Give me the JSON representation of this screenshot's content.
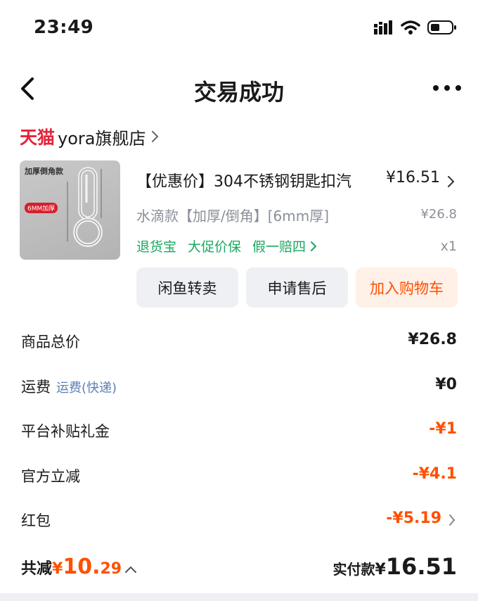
{
  "status_bar": {
    "time": "23:49"
  },
  "nav": {
    "title": "交易成功"
  },
  "shop": {
    "platform": "天猫",
    "name": "yora旗舰店"
  },
  "product": {
    "image_text_top": "加厚倒角款",
    "image_text_badge": "6MM加厚",
    "title": "【优惠价】304不锈钢钥匙扣汽",
    "price": "¥16.51",
    "spec": "水滴款【加厚/倒角】[6mm厚]",
    "original_price": "¥26.8",
    "services": [
      "退货宝",
      "大促价保",
      "假一赔四"
    ],
    "quantity": "x1"
  },
  "actions": {
    "resell": "闲鱼转卖",
    "after_sale": "申请售后",
    "add_cart": "加入购物车"
  },
  "summary": [
    {
      "label": "商品总价",
      "sub": "",
      "value": "¥26.8",
      "discount": false
    },
    {
      "label": "运费",
      "sub": "运费(快递)",
      "value": "¥0",
      "discount": false
    },
    {
      "label": "平台补贴礼金",
      "sub": "",
      "value": "-¥1",
      "discount": true
    },
    {
      "label": "官方立减",
      "sub": "",
      "value": "-¥4.1",
      "discount": true
    },
    {
      "label": "红包",
      "sub": "",
      "value": "-¥5.19",
      "discount": true
    }
  ],
  "footer": {
    "saved_label": "共减",
    "saved_yen": "¥",
    "saved_int": "10.",
    "saved_dec": "29",
    "paid_label": "实付款",
    "paid_yen": "¥",
    "paid_amount": "16.51"
  },
  "colors": {
    "accent": "#ff5000",
    "tmall_red": "#e5233a",
    "service_green": "#1aa85f",
    "link_blue": "#5d7fb4"
  }
}
